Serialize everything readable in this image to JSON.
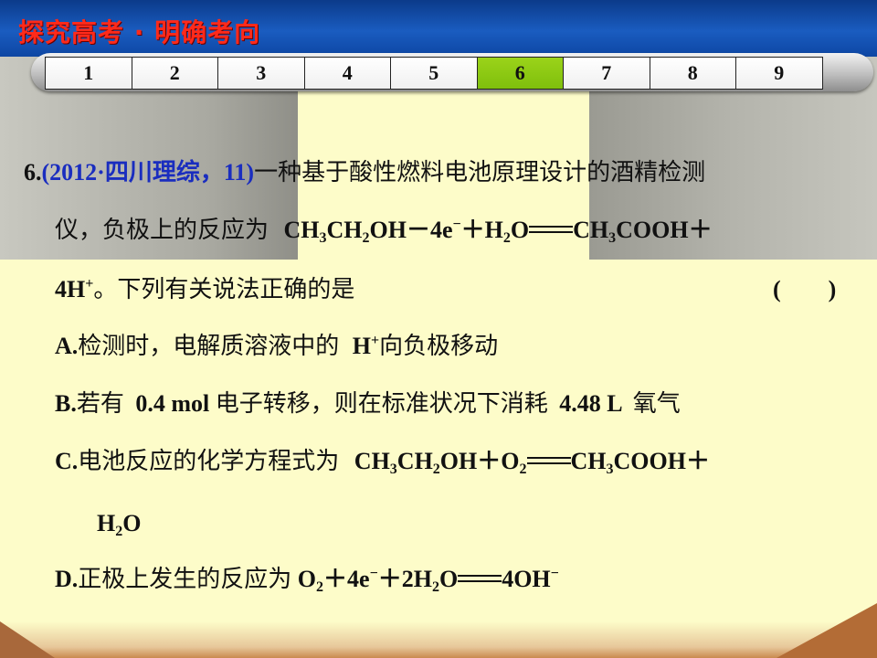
{
  "header": {
    "title": "探究高考 · 明确考向"
  },
  "tabs": [
    "1",
    "2",
    "3",
    "4",
    "5",
    "6",
    "7",
    "8",
    "9"
  ],
  "active_tab": "6",
  "question": {
    "number": "6.",
    "source": "(2012·四川理综，11)",
    "stem_1": "一种基于酸性燃料电池原理设计的酒精检测",
    "stem_2": "仪，负极上的反应为",
    "stem_3": "。下列有关说法正确的是",
    "paren_open": "(",
    "paren_close": ")"
  },
  "options": {
    "a_label": "A.",
    "a_text_1": "检测时，电解质溶液中的",
    "a_text_2": "向负极移动",
    "b_label": "B.",
    "b_text_1": "若有",
    "b_text_2": "电子转移，则在标准状况下消耗",
    "b_text_3": "氧气",
    "c_label": "C.",
    "c_text": "电池反应的化学方程式为",
    "d_label": "D.",
    "d_text": "正极上发生的反应为"
  },
  "chem": {
    "ch3": "CH",
    "ch2oh": "CH",
    "oh": "OH",
    "minus_4e": "－4e",
    "plus": "＋",
    "h2o": "H",
    "o": "O",
    "cooh": "COOH＋",
    "h_plus_4": "4H",
    "h": "H",
    "mol": "0.4 mol",
    "liters": "4.48 L",
    "o2": "O",
    "oh_minus": "4OH",
    "two_h2o": "2H",
    "plus_4e": "＋4e",
    "sub_3": "3",
    "sub_2": "2",
    "sup_plus": "+",
    "sup_minus": "−"
  }
}
